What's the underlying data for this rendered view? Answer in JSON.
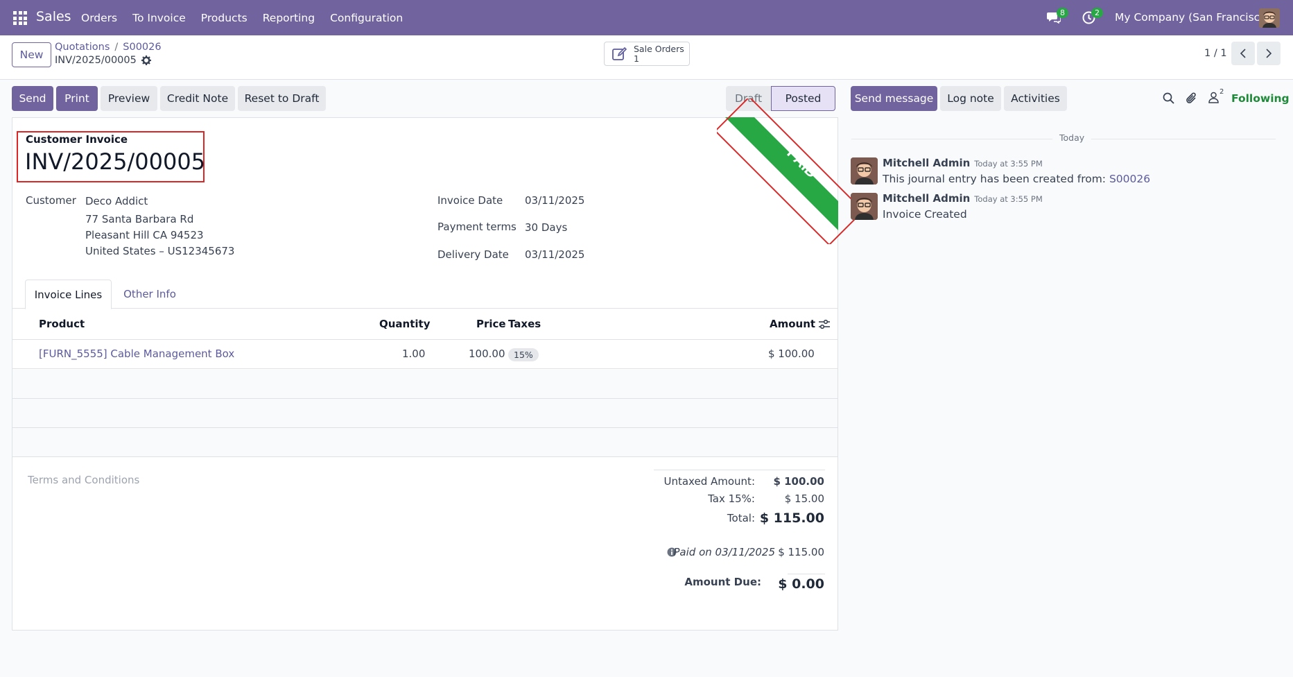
{
  "navbar": {
    "brand": "Sales",
    "menu": [
      "Orders",
      "To Invoice",
      "Products",
      "Reporting",
      "Configuration"
    ],
    "messages_count": "8",
    "activities_count": "2",
    "company": "My Company (San Francisco)",
    "accent": "#71639e"
  },
  "control": {
    "new_label": "New",
    "breadcrumb": [
      "Quotations",
      "S00026"
    ],
    "record_name": "INV/2025/00005",
    "smart_button": {
      "label": "Sale Orders",
      "count": "1"
    },
    "pager": "1 / 1"
  },
  "actions": {
    "send": "Send",
    "print": "Print",
    "preview": "Preview",
    "credit_note": "Credit Note",
    "reset_to_draft": "Reset to Draft"
  },
  "status": {
    "draft": "Draft",
    "posted": "Posted",
    "current": "Posted"
  },
  "ribbon": {
    "text": "PAID",
    "color": "#28a745"
  },
  "invoice": {
    "type": "Customer Invoice",
    "number": "INV/2025/00005",
    "customer_label": "Customer",
    "customer": {
      "name": "Deco Addict",
      "line1": "77 Santa Barbara Rd",
      "line2": "Pleasant Hill CA 94523",
      "line3": "United States – US12345673"
    },
    "invoice_date_label": "Invoice Date",
    "invoice_date": "03/11/2025",
    "payment_terms_label": "Payment terms",
    "payment_terms": "30 Days",
    "delivery_date_label": "Delivery Date",
    "delivery_date": "03/11/2025"
  },
  "tabs": [
    "Invoice Lines",
    "Other Info"
  ],
  "lines": {
    "headers": {
      "product": "Product",
      "quantity": "Quantity",
      "price": "Price",
      "taxes": "Taxes",
      "amount": "Amount"
    },
    "rows": [
      {
        "product": "[FURN_5555] Cable Management Box",
        "quantity": "1.00",
        "price": "100.00",
        "taxes": "15%",
        "amount": "$ 100.00"
      }
    ]
  },
  "terms_placeholder": "Terms and Conditions",
  "totals": {
    "untaxed_label": "Untaxed Amount:",
    "untaxed": "$ 100.00",
    "tax_label": "Tax 15%:",
    "tax": "$ 15.00",
    "total_label": "Total:",
    "total": "$ 115.00",
    "paid_label": "Paid on 03/11/2025",
    "paid": "$ 115.00",
    "due_label": "Amount Due:",
    "due": "$ 0.00"
  },
  "chatter": {
    "send_message": "Send message",
    "log_note": "Log note",
    "activities": "Activities",
    "followers_count": "2",
    "following": "Following",
    "date_separator": "Today",
    "messages": [
      {
        "author": "Mitchell Admin",
        "time": "Today at 3:55 PM",
        "body": "This journal entry has been created from: ",
        "link": "S00026"
      },
      {
        "author": "Mitchell Admin",
        "time": "Today at 3:55 PM",
        "body": "Invoice Created"
      }
    ]
  }
}
